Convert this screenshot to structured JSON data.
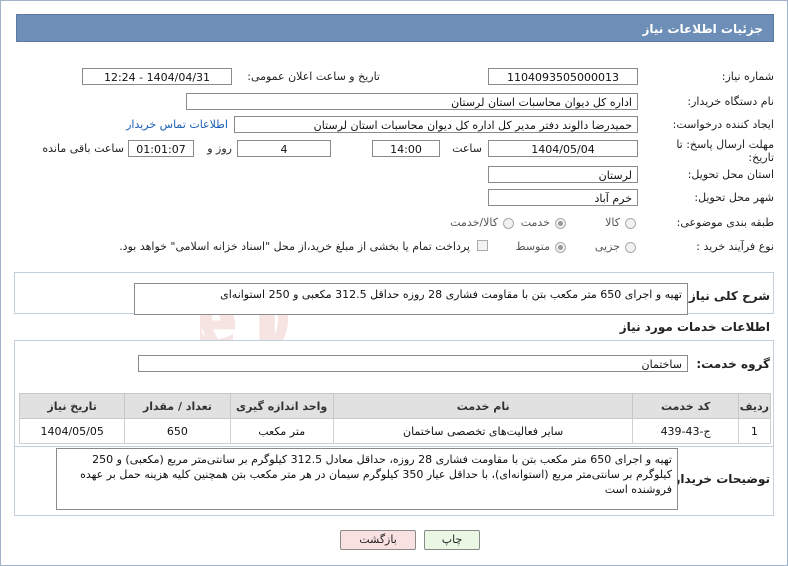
{
  "header": {
    "title": "جزئیات اطلاعات نیاز"
  },
  "need_number": {
    "label": "شماره نیاز:",
    "value": "1104093505000013"
  },
  "announce_datetime": {
    "label": "تاریخ و ساعت اعلان عمومی:",
    "value": "1404/04/31 - 12:24"
  },
  "buyer_org": {
    "label": "نام دستگاه خریدار:",
    "value": "اداره کل دیوان محاسبات استان لرستان"
  },
  "requester": {
    "label": "ایجاد کننده درخواست:",
    "value": "حمیدرضا دالوند دفتر  مدیر کل اداره کل دیوان محاسبات استان لرستان",
    "contact_link": "اطلاعات تماس خریدار"
  },
  "deadline": {
    "label_line1": "مهلت ارسال پاسخ: تا",
    "label_line2": "تاریخ:",
    "date": "1404/05/04",
    "time_label": "ساعت",
    "time": "14:00",
    "days": "4",
    "days_label": "روز و",
    "remaining": "01:01:07",
    "remaining_label": "ساعت باقی مانده"
  },
  "delivery_province": {
    "label": "استان محل تحویل:",
    "value": "لرستان"
  },
  "delivery_city": {
    "label": "شهر محل تحویل:",
    "value": "خرم آباد"
  },
  "category": {
    "label": "طبقه بندی موضوعی:",
    "options": [
      "کالا",
      "خدمت",
      "کالا/خدمت"
    ],
    "selected": "خدمت"
  },
  "process": {
    "label": "نوع فرآیند خرید :",
    "options": [
      "جزیی",
      "متوسط"
    ],
    "selected": "متوسط",
    "treasury_note": "پرداخت تمام یا بخشی از مبلغ خرید،از محل \"اسناد خزانه اسلامی\" خواهد بود."
  },
  "summary": {
    "label": "شرح کلی نیاز:",
    "value": "تهیه و اجرای 650 متر مکعب بتن با مقاومت فشاری 28 روزه حداقل 312.5 مکعبی و 250 استوانه‌ای"
  },
  "services_info": {
    "title": "اطلاعات خدمات مورد نیاز"
  },
  "service_group": {
    "label": "گروه خدمت:",
    "value": "ساختمان"
  },
  "table": {
    "columns": [
      "ردیف",
      "کد خدمت",
      "نام خدمت",
      "واحد اندازه گیری",
      "تعداد / مقدار",
      "تاریخ نیاز"
    ],
    "rows": [
      [
        "1",
        "ج-43-439",
        "سایر فعالیت‌های تخصصی ساختمان",
        "متر مکعب",
        "650",
        "1404/05/05"
      ]
    ]
  },
  "buyer_notes": {
    "label": "توضیحات خریدار:",
    "value": "تهیه و اجرای 650 متر مکعب بتن با مقاومت فشاری 28 روزه، حداقل معادل 312.5 کیلوگرم بر سانتی‌متر مربع (مکعبی) و 250 کیلوگرم بر سانتی‌متر مربع (استوانه‌ای)، با حداقل عیار 350 کیلوگرم سیمان در هر متر مکعب بتن همچنین کلیه هزینه حمل بر عهده فروشنده است"
  },
  "buttons": {
    "print": "چاپ",
    "back": "بازگشت"
  },
  "watermark": {
    "text": "AriaTender.neT"
  },
  "colors": {
    "header_bg": "#6d8eb6",
    "print_bg": "#e9f7e4",
    "back_bg": "#f9e1e1"
  }
}
